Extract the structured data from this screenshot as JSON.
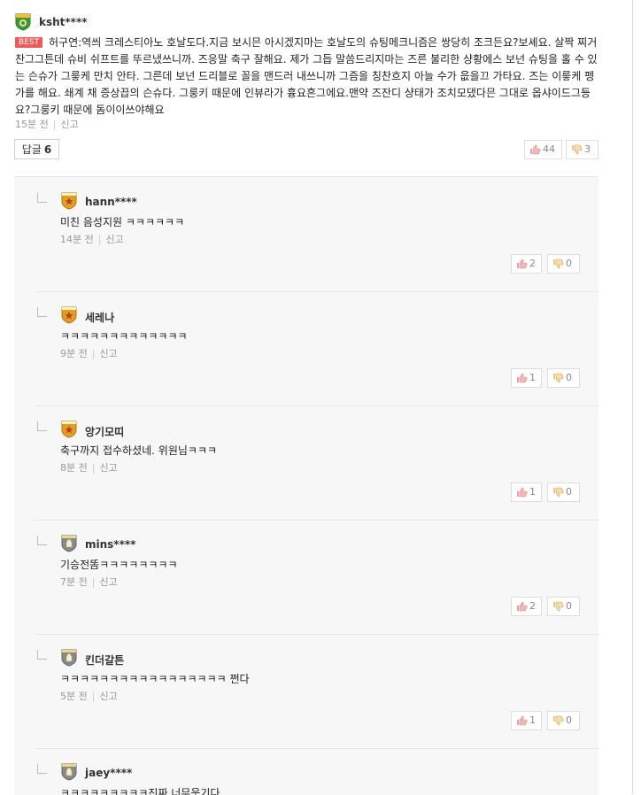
{
  "main": {
    "author": "ksht****",
    "best_label": "BEST",
    "text": "허구연:역씌 크레스티아노 호날도다.지금 보시믄 아시겠지마는 호날도의 슈팅메크니즘은 쌍당히 조크든요?보셰요. 살짝 찌거 찬그그튼데 슈비 쉬프트를 뚜르냈쓰니까. 즈응말 축구 잘해요. 제가 그듭 말씀드리지마는 즈른 불리한 샹황에스 보넌 슈팅을 홀 수 있는 슨슈가 그릏케 만치 안타. 그른데 보넌 드리블로 꼴을 맨드러 내쓰니까 그즘을 칭찬흐지 아늘 수가 읎을끄 가타요. 즈는 이릏케 펭가를 해요. 쇄계 채 증상끕의 슨슈다. 그룽키 때문에 인뷰라가 흉요흔그에요.맨약 즈잔디 샹태가 조치모댔다믄 그대로 옵샤이드그등요?그룽키 때문에 돔이이쓰야해요",
    "time": "15분 전",
    "report": "신고",
    "reply_label": "답글",
    "reply_count": "6",
    "likes": "44",
    "dislikes": "3"
  },
  "replies": [
    {
      "author": "hann****",
      "text": "미친 음성지원 ㅋㅋㅋㅋㅋㅋ",
      "time": "14분 전",
      "report": "신고",
      "likes": "2",
      "dislikes": "0",
      "badge": "gold"
    },
    {
      "author": "세레나",
      "text": "ㅋㅋㅋㅋㅋㅋㅋㅋㅋㅋㅋㅋㅋ",
      "time": "9분 전",
      "report": "신고",
      "likes": "1",
      "dislikes": "0",
      "badge": "gold"
    },
    {
      "author": "앙기모띠",
      "text": "축구까지 접수하셨네. 위원님ㅋㅋㅋ",
      "time": "8분 전",
      "report": "신고",
      "likes": "1",
      "dislikes": "0",
      "badge": "gold"
    },
    {
      "author": "mins****",
      "text": "기승전똠ㅋㅋㅋㅋㅋㅋㅋㅋ",
      "time": "7분 전",
      "report": "신고",
      "likes": "2",
      "dislikes": "0",
      "badge": "gray"
    },
    {
      "author": "킨더갈튼",
      "text": "ㅋㅋㅋㅋㅋㅋㅋㅋㅋㅋㅋㅋㅋㅋㅋㅋㅋ 쩐다",
      "time": "5분 전",
      "report": "신고",
      "likes": "1",
      "dislikes": "0",
      "badge": "gray"
    },
    {
      "author": "jaey****",
      "text": "ㅋㅋㅋㅋㅋㅋㅋㅋㅋ진짜 너무웃기다",
      "time": "",
      "report": "",
      "likes": "",
      "dislikes": "",
      "badge": "gray"
    }
  ],
  "icons": {
    "main_badge": "green-shield-icon",
    "gold_badge": "gold-star-shield-icon",
    "gray_badge": "gray-glove-shield-icon",
    "like": "thumbs-up-icon",
    "dislike": "thumbs-down-icon"
  },
  "colors": {
    "best": "#f05a5a",
    "gold": "#e0a020",
    "green": "#3a9a3a",
    "gray": "#8a8a8a"
  }
}
